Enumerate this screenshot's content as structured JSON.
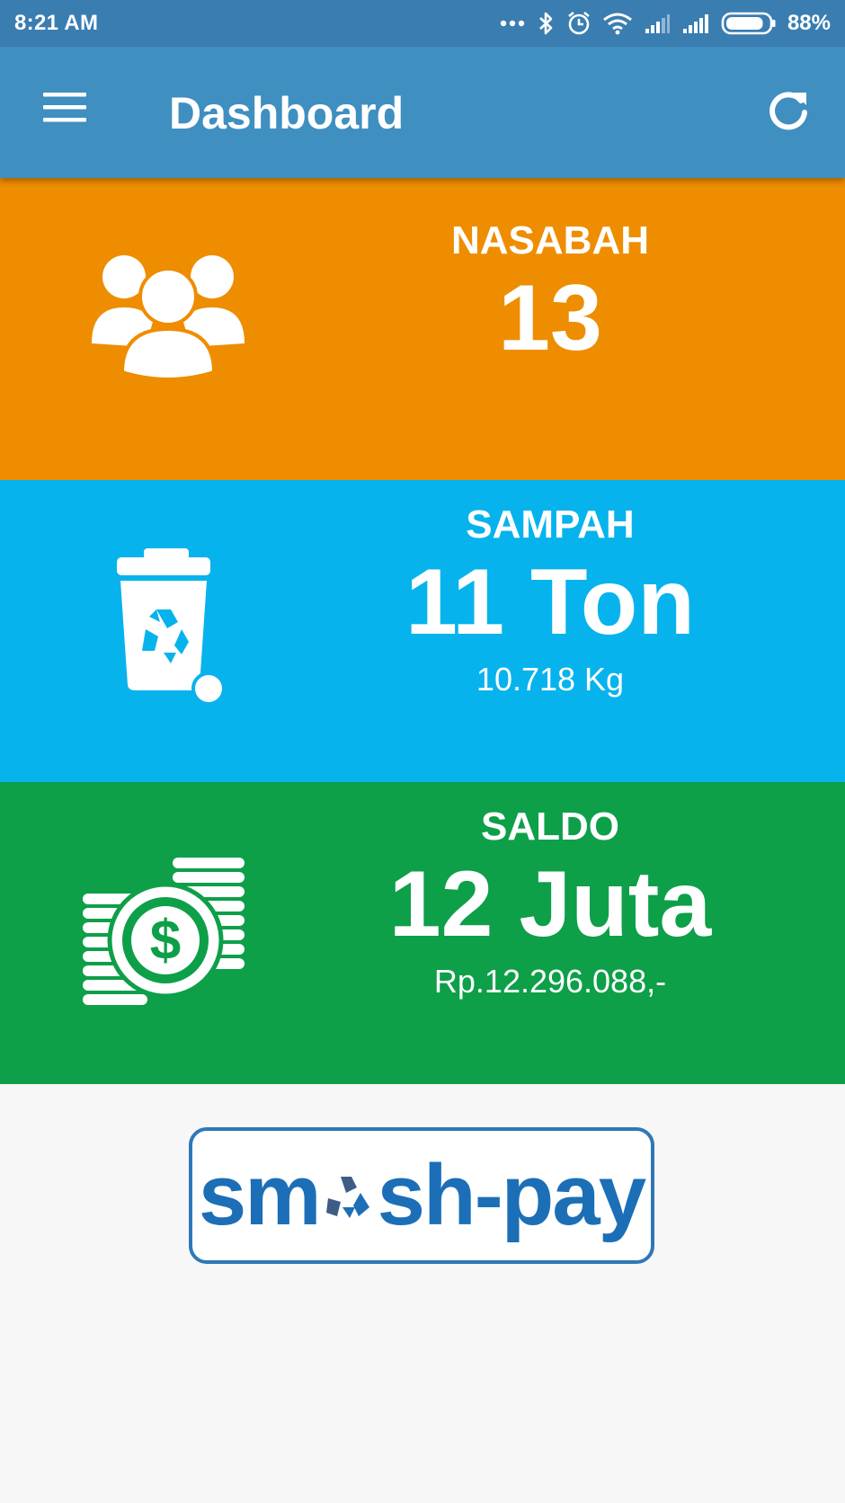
{
  "status_bar": {
    "time": "8:21 AM",
    "battery_percent": "88%",
    "battery_level": 0.88,
    "icons": [
      "more-dots-icon",
      "bluetooth-icon",
      "alarm-icon",
      "wifi-icon",
      "signal-icon-1",
      "signal-icon-2",
      "battery-icon"
    ]
  },
  "app_bar": {
    "title": "Dashboard",
    "menu_icon": "hamburger-menu-icon",
    "refresh_icon": "refresh-icon"
  },
  "cards": {
    "nasabah": {
      "label": "NASABAH",
      "value": "13",
      "icon": "users-group-icon",
      "color": "#ee8d00"
    },
    "sampah": {
      "label": "SAMPAH",
      "value": "11 Ton",
      "sub": "10.718 Kg",
      "icon": "recycle-bin-icon",
      "color": "#07b3ec"
    },
    "saldo": {
      "label": "SALDO",
      "value": "12 Juta",
      "sub": "Rp.12.296.088,-",
      "icon": "dollar-coins-icon",
      "color": "#0e9f49"
    }
  },
  "logo": {
    "text_before": "sm",
    "text_after": "sh-pay",
    "color": "#1c6fb6"
  }
}
